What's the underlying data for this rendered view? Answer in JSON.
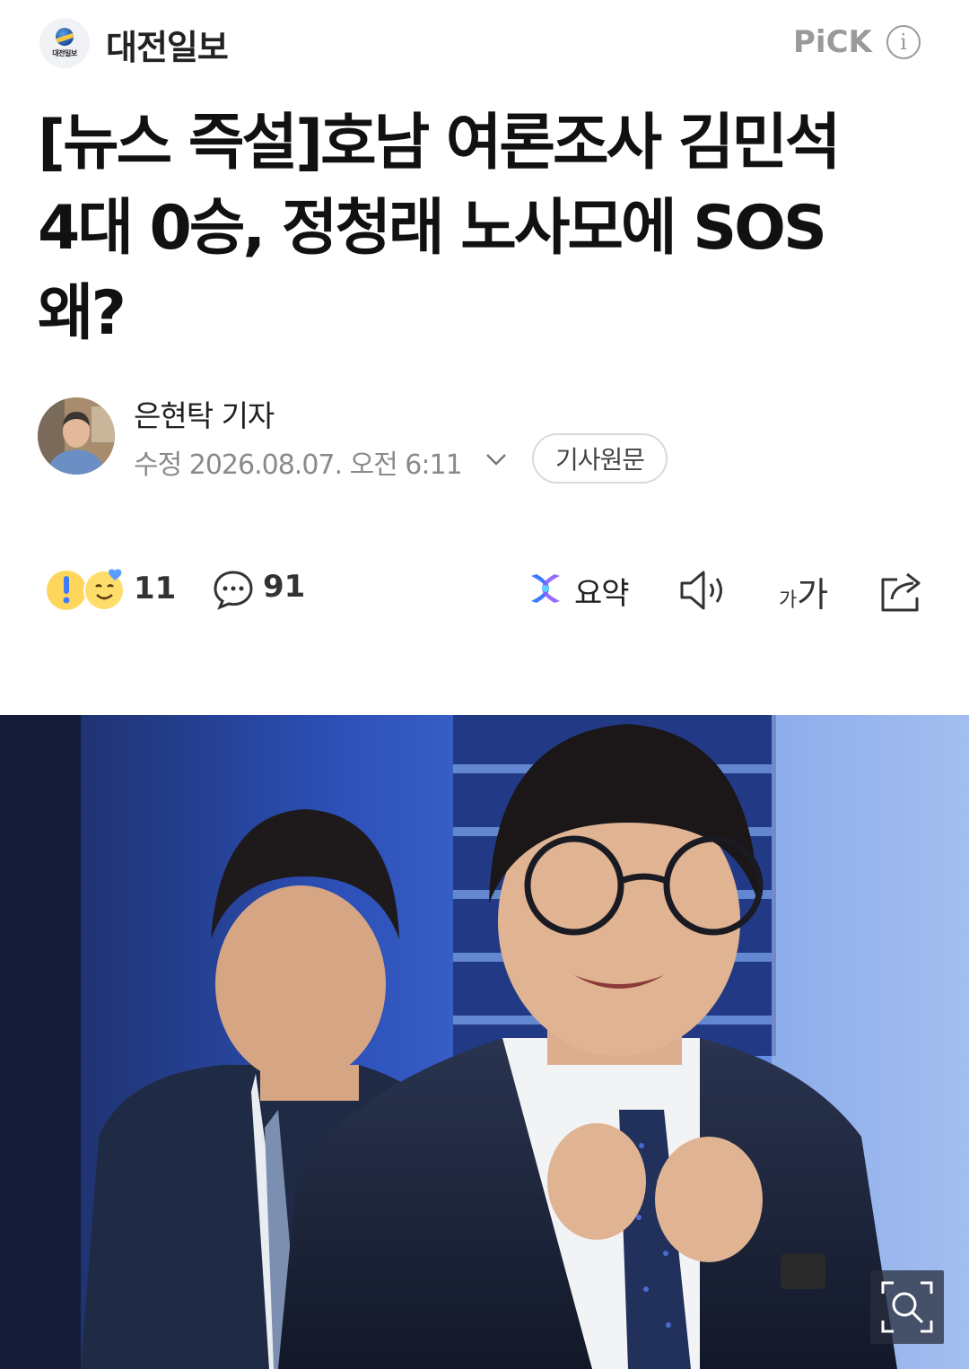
{
  "header": {
    "press_logo_text": "대전일보",
    "press_name": "대전일보",
    "pick_label": "PiCK",
    "info_glyph": "i"
  },
  "article": {
    "headline_lines": [
      "[뉴스 즉설]호남 여론조사 김민석",
      "4대 0승, 정청래 노사모에 SOS",
      "왜?"
    ]
  },
  "byline": {
    "reporter": "은현탁 기자",
    "modified": "수정 2026.08.07. 오전 6:11",
    "original_button": "기사원문"
  },
  "actions": {
    "reaction_count": "11",
    "comment_count": "91",
    "summary_label": "요약",
    "font_small": "가",
    "font_large": "가"
  },
  "colors": {
    "text_primary": "#111111",
    "text_muted": "#8a8a8a",
    "summary_blue": "#3d7bff",
    "summary_purple": "#8a5cff"
  },
  "icons": [
    "info-icon",
    "chevron-down-icon",
    "emoji-icon",
    "comment-icon",
    "summary-icon",
    "speaker-icon",
    "share-icon",
    "zoom-icon"
  ]
}
